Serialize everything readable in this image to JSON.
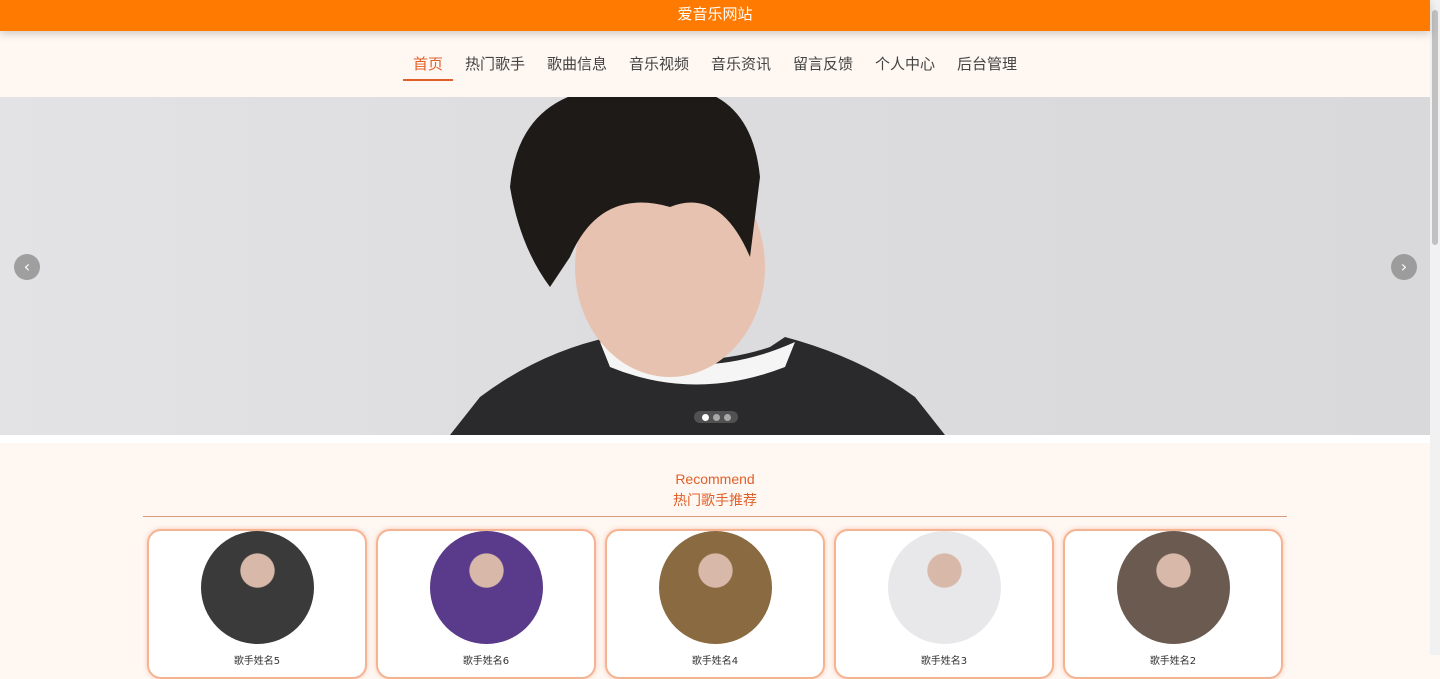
{
  "site_title": "爱音乐网站",
  "nav": [
    {
      "label": "首页",
      "active": true
    },
    {
      "label": "热门歌手"
    },
    {
      "label": "歌曲信息"
    },
    {
      "label": "音乐视频"
    },
    {
      "label": "音乐资讯"
    },
    {
      "label": "留言反馈"
    },
    {
      "label": "个人中心"
    },
    {
      "label": "后台管理"
    }
  ],
  "carousel": {
    "prev": "‹",
    "next": "›",
    "slide_count": 3,
    "active_slide": 0
  },
  "recommend": {
    "en": "Recommend",
    "cn": "热门歌手推荐"
  },
  "singers": [
    {
      "name": "歌手姓名5",
      "color": "#3a3a3a"
    },
    {
      "name": "歌手姓名6",
      "color": "#5a3a8a"
    },
    {
      "name": "歌手姓名4",
      "color": "#8a6a40"
    },
    {
      "name": "歌手姓名3",
      "color": "#e8e8ea"
    },
    {
      "name": "歌手姓名2",
      "color": "#6a5a50"
    }
  ]
}
